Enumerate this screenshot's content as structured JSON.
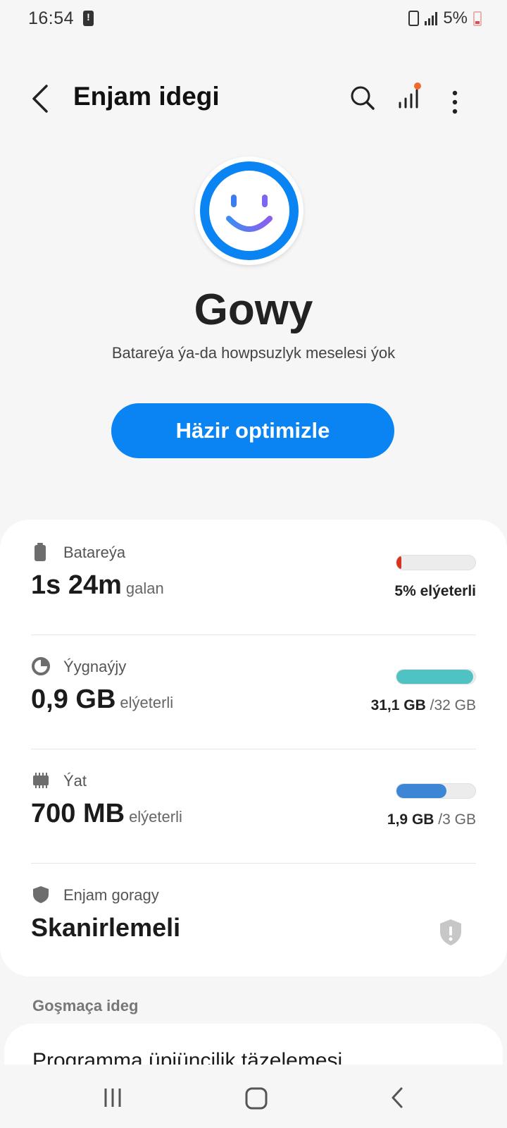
{
  "status_bar": {
    "time": "16:54",
    "battery_percent": "5%",
    "icons": [
      "alert-icon",
      "recycle-icon",
      "signal-icon",
      "battery-low-icon"
    ]
  },
  "app_bar": {
    "title": "Enjam idegi",
    "icons": [
      "back-arrow-icon",
      "search-icon",
      "stats-icon",
      "more-vertical-icon"
    ],
    "notification_dot_color": "#f26a2e"
  },
  "hero": {
    "icon": "smiley-icon",
    "status": "Gowy",
    "subtitle": "Batareýa ýa-da howpsuzlyk meselesi ýok",
    "button_label": "Häzir optimizle",
    "accent_color": "#0a84f2"
  },
  "items": {
    "battery": {
      "label": "Batareýa",
      "value": "1s 24m",
      "unit": "galan",
      "right_text": "5% elýeterli",
      "fill_fraction": 0.05,
      "bar_color": "#d9321f"
    },
    "storage": {
      "label": "Ýygnaýjy",
      "value": "0,9 GB",
      "unit": "elýeterli",
      "right_used": "31,1 GB",
      "right_total": "/32 GB",
      "fill_fraction": 0.97,
      "bar_color": "#4fc3c3"
    },
    "memory": {
      "label": "Ýat",
      "value": "700 MB",
      "unit": "elýeterli",
      "right_used": "1,9 GB",
      "right_total": "/3 GB",
      "fill_fraction": 0.63,
      "bar_color": "#3d86d6"
    },
    "security": {
      "label": "Enjam goragy",
      "value": "Skanirlemeli"
    }
  },
  "additional": {
    "header": "Goşmaça ideg",
    "first_item": "Programma üpjüncilik täzelemesi"
  },
  "nav_bar": {
    "icons": [
      "recents-icon",
      "home-icon",
      "back-icon"
    ]
  }
}
